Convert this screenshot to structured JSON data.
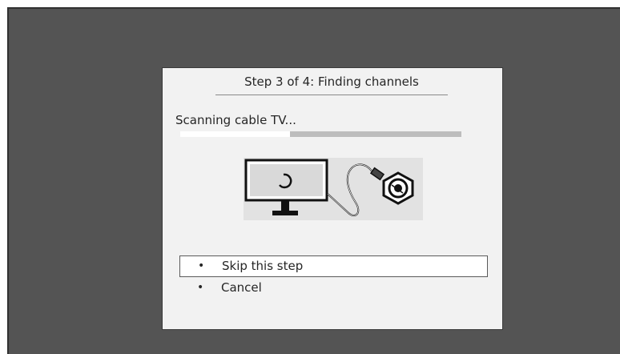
{
  "dialog": {
    "title": "Step 3 of 4: Finding channels",
    "status": "Scanning cable TV...",
    "progress": 0.39
  },
  "illustration": {
    "tv_icon": "tv-with-spinner-icon",
    "cable_icon": "coax-cable-icon"
  },
  "menu": {
    "bullet": "•",
    "items": [
      {
        "label": "Skip this step",
        "selected": true
      },
      {
        "label": "Cancel",
        "selected": false
      }
    ]
  },
  "colors": {
    "screen_background": "#545454",
    "dialog_background": "#f2f2f2",
    "progress_track": "#bdbdbd",
    "progress_fill": "#ffffff",
    "text": "#262626"
  }
}
